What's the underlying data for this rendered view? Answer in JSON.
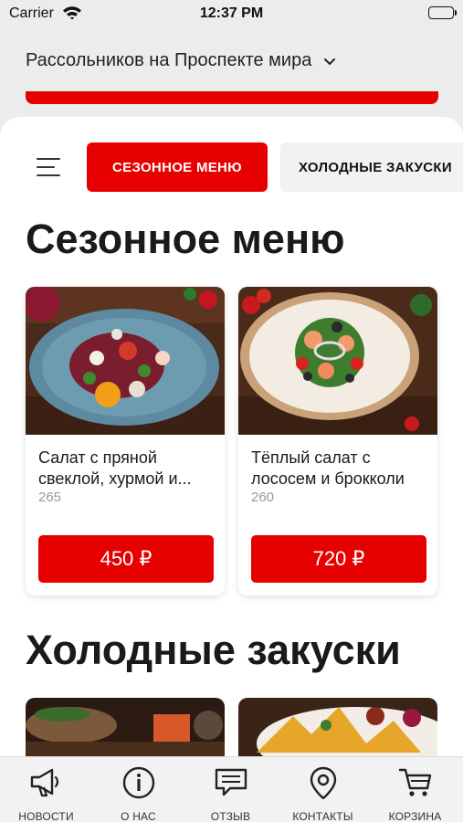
{
  "status_bar": {
    "carrier": "Carrier",
    "time": "12:37 PM"
  },
  "header": {
    "restaurant": "Рассольников на Проспекте мира",
    "dropdown_icon": "chevron-down-icon"
  },
  "categories": {
    "active": "СЕЗОННОЕ МЕНЮ",
    "next": "ХОЛОДНЫЕ ЗАКУСКИ"
  },
  "sections": [
    {
      "title": "Сезонное меню",
      "products": [
        {
          "name": "Салат с пряной свеклой, хурмой и...",
          "weight": "265",
          "price": "450 ₽"
        },
        {
          "name": "Тёплый салат с лососем и брокколи",
          "weight": "260",
          "price": "720 ₽"
        }
      ]
    },
    {
      "title": "Холодные закуски"
    }
  ],
  "bottom_nav": [
    {
      "label": "НОВОСТИ",
      "icon": "megaphone-icon"
    },
    {
      "label": "О НАС",
      "icon": "info-icon"
    },
    {
      "label": "ОТЗЫВ",
      "icon": "chat-icon"
    },
    {
      "label": "КОНТАКТЫ",
      "icon": "location-pin-icon"
    },
    {
      "label": "КОРЗИНА",
      "icon": "cart-icon"
    }
  ],
  "colors": {
    "accent": "#e60000",
    "background": "#ececec",
    "card": "#ffffff"
  }
}
